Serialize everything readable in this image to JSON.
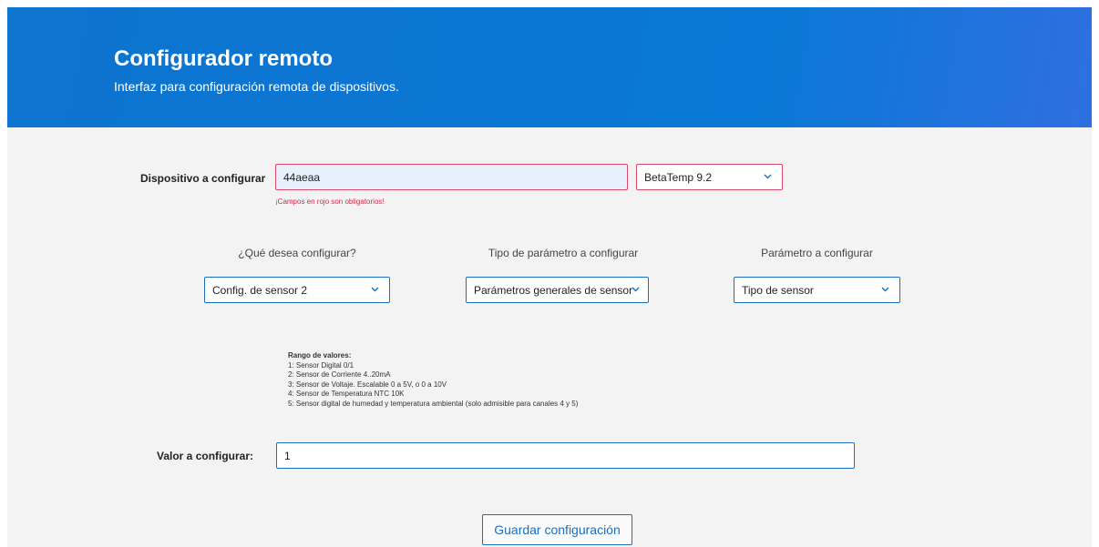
{
  "header": {
    "title": "Configurador remoto",
    "subtitle": "Interfaz para configuración remota de dispositivos."
  },
  "device": {
    "label": "Dispositivo a configurar",
    "id_value": "44aeaa",
    "model_selected": "BetaTemp 9.2",
    "error": "¡Campos en rojo son obligatorios!"
  },
  "config": {
    "what_label": "¿Qué desea configurar?",
    "what_selected": "Config. de sensor 2",
    "param_type_label": "Tipo de parámetro a configurar",
    "param_type_selected": "Parámetros generales de sensor",
    "param_label": "Parámetro a configurar",
    "param_selected": "Tipo de sensor"
  },
  "range": {
    "title": "Rango de valores:",
    "items": [
      "1: Sensor Digital 0/1",
      "2: Sensor de Corriente 4..20mA",
      "3: Sensor de Voltaje. Escalable 0 a 5V, o 0 a 10V",
      "4: Sensor de Temperatura NTC 10K",
      "5: Sensor digital de humedad y temperatura ambiental (solo admisible para canales 4 y 5)"
    ]
  },
  "value": {
    "label": "Valor a configurar:",
    "current": "1"
  },
  "save_button": "Guardar configuración",
  "icons": {
    "dropdown": "chevron-down-icon"
  },
  "colors": {
    "header_blue": "#0a78d6",
    "accent": "#1b6fc0",
    "required_border": "#d94a6b",
    "error_text": "#e0264a"
  }
}
